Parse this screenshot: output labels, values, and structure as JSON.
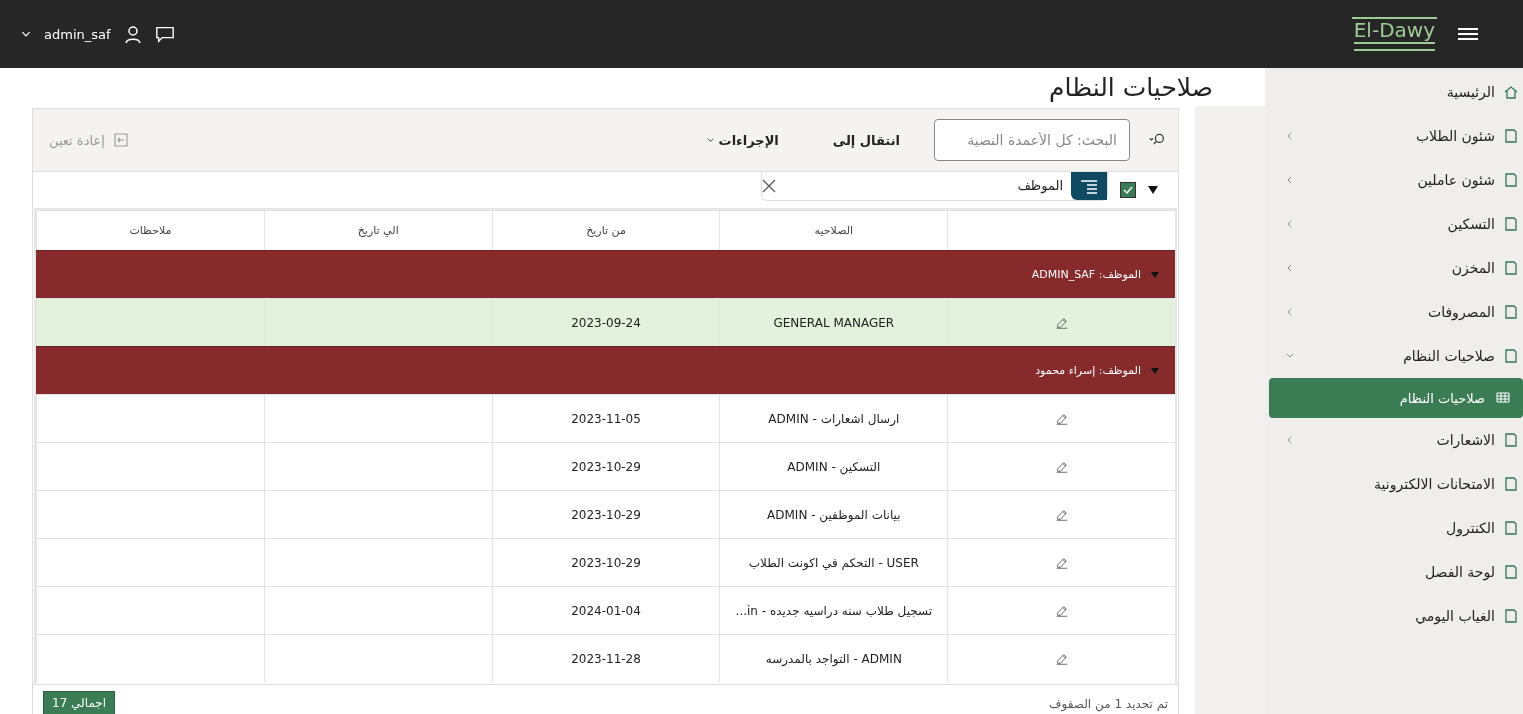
{
  "topbar": {
    "logo": "El-Dawy",
    "user": "admin_saf"
  },
  "sidebar": {
    "items": [
      {
        "label": "الرئيسية",
        "kind": "link"
      },
      {
        "label": "شئون الطلاب",
        "kind": "group",
        "expanded": false
      },
      {
        "label": "شئون عاملين",
        "kind": "group",
        "expanded": false
      },
      {
        "label": "التسكين",
        "kind": "group",
        "expanded": false
      },
      {
        "label": "المخزن",
        "kind": "group",
        "expanded": false
      },
      {
        "label": "المصروفات",
        "kind": "group",
        "expanded": false
      },
      {
        "label": "صلاحيات النظام",
        "kind": "group",
        "expanded": true,
        "children": [
          {
            "label": "صلاحيات النظام",
            "selected": true
          }
        ]
      },
      {
        "label": "الاشعارات",
        "kind": "group",
        "expanded": false
      },
      {
        "label": "الامتحانات الالكترونية",
        "kind": "link"
      },
      {
        "label": "الكنترول",
        "kind": "link"
      },
      {
        "label": "لوحة الفصل",
        "kind": "link"
      },
      {
        "label": "الغياب اليومي",
        "kind": "link"
      }
    ]
  },
  "page": {
    "title": "صلاحيات النظام"
  },
  "toolbar": {
    "search_placeholder": "البحث: كل الأعمدة النصية",
    "goto": "انتقال إلى",
    "actions": "الإجراءات",
    "reset": {
      "label": "إعادة تعين",
      "disabled": true
    }
  },
  "filter": {
    "label": "الموظف",
    "checked": true
  },
  "table": {
    "columns": [
      "الصلاحيه",
      "من تاريخ",
      "الي تاريخ",
      "ملاحظات"
    ],
    "groups": [
      {
        "label": "الموظف: ADMIN_SAF",
        "expanded": true,
        "rows": [
          {
            "permission": "GENERAL MANAGER",
            "from_date": "2023-09-24",
            "selected": true
          }
        ]
      },
      {
        "label": "الموظف: إسراء محمود",
        "expanded": true,
        "rows": [
          {
            "permission": "ارسال اشعارات - ADMIN",
            "from_date": "2023-11-05",
            "selected": false
          },
          {
            "permission": "التسكين - ADMIN",
            "from_date": "2023-10-29",
            "selected": false
          },
          {
            "permission": "بيانات الموظفين - ADMIN",
            "from_date": "2023-10-29",
            "selected": false
          },
          {
            "permission": "USER - التحكم في اكونت الطلاب",
            "from_date": "2023-10-29",
            "selected": false
          },
          {
            "permission": "تسجيل طلاب سنه دراسيه جديده - in...",
            "from_date": "2024-01-04",
            "selected": false
          },
          {
            "permission": "ADMIN - التواجد بالمدرسه",
            "from_date": "2023-11-28",
            "selected": false
          }
        ]
      }
    ]
  },
  "footer": {
    "selection": "تم تحديد 1 من الصفوف",
    "total": "اجمالي 17"
  }
}
